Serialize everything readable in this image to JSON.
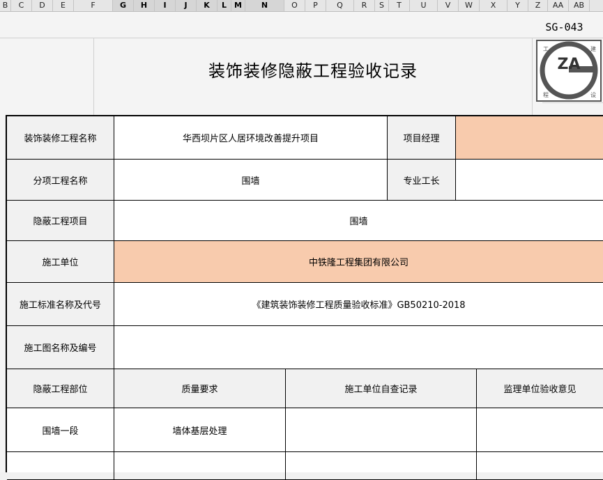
{
  "columns": [
    "B",
    "C",
    "D",
    "E",
    "F",
    "G",
    "H",
    "I",
    "J",
    "K",
    "L",
    "M",
    "N",
    "O",
    "P",
    "Q",
    "R",
    "S",
    "T",
    "U",
    "V",
    "W",
    "X",
    "Y",
    "Z",
    "AA",
    "AB"
  ],
  "form": {
    "code": "SG-043",
    "title": "装饰装修隐蔽工程验收记录"
  },
  "logo": {
    "center": "ZA",
    "corners": [
      "工",
      "建",
      "程",
      "设"
    ]
  },
  "table": {
    "rows": [
      {
        "label": "装饰装修工程名称",
        "value": "华西坝片区人居环境改善提升项目",
        "sub_label": "项目经理",
        "sub_value": ""
      },
      {
        "label": "分项工程名称",
        "value": "围墙",
        "sub_label": "专业工长",
        "sub_value": ""
      },
      {
        "label": "隐蔽工程项目",
        "value": "围墙"
      },
      {
        "label": "施工单位",
        "value": "中铁隆工程集团有限公司"
      },
      {
        "label": "施工标准名称及代号",
        "value": "《建筑装饰装修工程质量验收标准》GB50210-2018"
      },
      {
        "label": "施工图名称及编号",
        "value": ""
      }
    ],
    "headers": [
      "隐蔽工程部位",
      "质量要求",
      "施工单位自查记录",
      "监理单位验收意见"
    ],
    "items": [
      [
        "围墙一段",
        "墙体基层处理",
        "",
        ""
      ],
      [
        "",
        "",
        "",
        ""
      ]
    ]
  }
}
